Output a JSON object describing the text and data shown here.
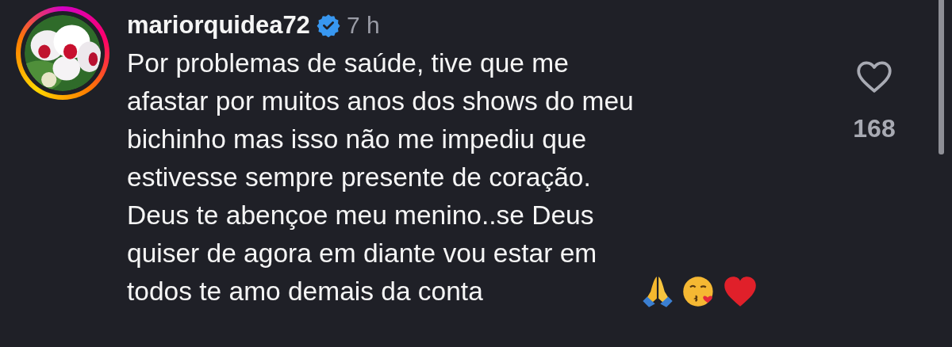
{
  "comment": {
    "username": "mariorquidea72",
    "verified": true,
    "time": "7 h",
    "text": "Por problemas de saúde, tive que me\nafastar por muitos anos dos shows do meu\nbichinho mas isso não me impediu que\nestivesse sempre presente de coração.\nDeus te abençoe meu menino..se Deus\nquiser de agora em diante vou estar em\ntodos te amo demais da conta",
    "likes": "168",
    "liked": false
  }
}
